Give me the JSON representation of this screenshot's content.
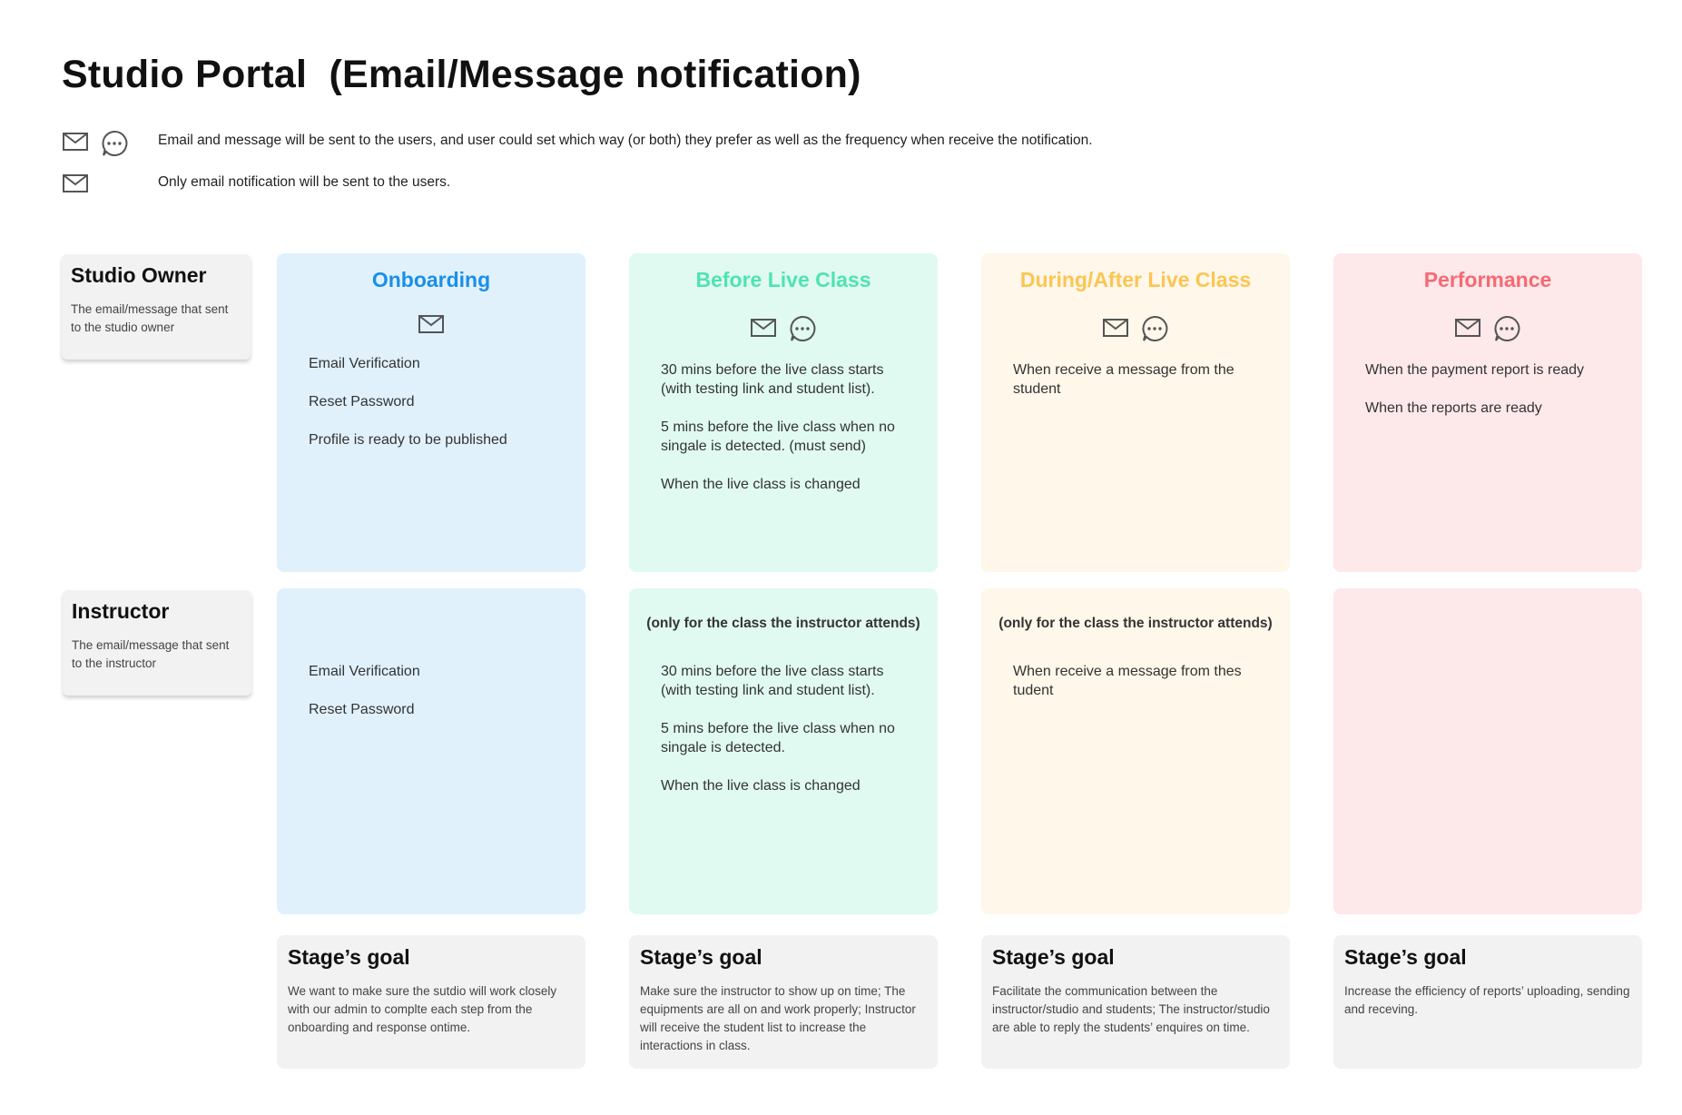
{
  "title": "Studio Portal  (Email/Message notification)",
  "legend": [
    {
      "icons": [
        "mail-icon",
        "chat-bubble-icon"
      ],
      "text": "Email and message will be sent to the users, and user could set which way (or both) they prefer as well as the frequency when receive the notification."
    },
    {
      "icons": [
        "mail-icon"
      ],
      "text": "Only email notification will be sent to the users."
    }
  ],
  "roles": [
    {
      "title": "Studio Owner",
      "desc": "The email/message that sent to the studio owner"
    },
    {
      "title": "Instructor",
      "desc": "The email/message that sent to the instructor"
    }
  ],
  "stages": [
    {
      "title": "Onboarding",
      "color": "#1a8fe8",
      "bg": "#e0f1fc",
      "icons": [
        "mail-icon"
      ]
    },
    {
      "title": "Before Live Class",
      "color": "#4fe3b2",
      "bg": "#e0faf2",
      "icons": [
        "mail-icon",
        "chat-bubble-icon"
      ]
    },
    {
      "title": "During/After Live Class",
      "color": "#fcc552",
      "bg": "#fef7ea",
      "icons": [
        "mail-icon",
        "chat-bubble-icon"
      ]
    },
    {
      "title": "Performance",
      "color": "#f56a72",
      "bg": "#fde8ea",
      "icons": [
        "mail-icon",
        "chat-bubble-icon"
      ]
    }
  ],
  "owner_items": [
    [
      "Email Verification",
      "Reset Password",
      "Profile is ready to be published"
    ],
    [
      "30 mins before the live class starts (with testing link and student list).",
      "5 mins before the live class when no singale is detected. (must send)",
      "When the live class is changed"
    ],
    [
      "When receive a message from the student"
    ],
    [
      "When the payment report is ready",
      "When the reports are ready"
    ]
  ],
  "instructor_notes": [
    "",
    "(only for the class the instructor attends)",
    "(only for the class the instructor attends)",
    ""
  ],
  "instructor_items": [
    [
      "Email Verification",
      "Reset Password"
    ],
    [
      "30 mins before the live class starts (with testing link and student list).",
      "5 mins before the live class when no singale is detected.",
      "When the live class is changed"
    ],
    [
      "When receive a message from thes tudent"
    ],
    []
  ],
  "goals": [
    {
      "title": "Stage’s goal",
      "text": "We want to make sure the sutdio will work closely with our admin to complte each step from the onboarding and response ontime."
    },
    {
      "title": "Stage’s goal",
      "text": "Make sure the instructor to show up on time; The equipments are all on and work properly; Instructor will receive the student list to increase the interactions in class."
    },
    {
      "title": "Stage’s goal",
      "text": "Facilitate the communication between the instructor/studio and students; The instructor/studio are able to reply the students’ enquires on time."
    },
    {
      "title": "Stage’s goal",
      "text": "Increase the efficiency of reports’ uploading, sending and receving."
    }
  ]
}
